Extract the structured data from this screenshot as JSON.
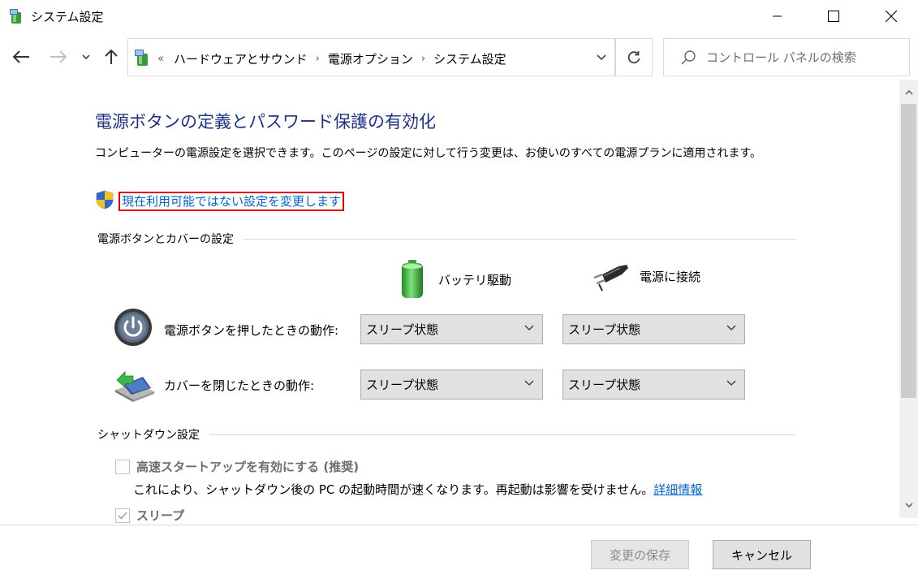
{
  "window": {
    "title": "システム設定"
  },
  "address": {
    "crumb_prefix": "«",
    "crumbs": [
      "ハードウェアとサウンド",
      "電源オプション",
      "システム設定"
    ],
    "separator": "›"
  },
  "search": {
    "placeholder": "コントロール パネルの検索"
  },
  "main": {
    "title": "電源ボタンの定義とパスワード保護の有効化",
    "description": "コンピューターの電源設定を選択できます。このページの設定に対して行う変更は、お使いのすべての電源プランに適用されます。",
    "change_link": "現在利用可能ではない設定を変更します",
    "power_section": "電源ボタンとカバーの設定",
    "col_battery": "バッテリ駆動",
    "col_plugged": "電源に接続",
    "row_power_label": "電源ボタンを押したときの動作:",
    "row_lid_label": "カバーを閉じたときの動作:",
    "power_battery_value": "スリープ状態",
    "power_plugged_value": "スリープ状態",
    "lid_battery_value": "スリープ状態",
    "lid_plugged_value": "スリープ状態",
    "shutdown_section": "シャットダウン設定",
    "fast_startup_label": "高速スタートアップを有効にする (推奨)",
    "fast_startup_desc": "これにより、シャットダウン後の PC の起動時間が速くなります。再起動は影響を受けません。",
    "more_info_link": "詳細情報",
    "sleep_label": "スリープ"
  },
  "footer": {
    "save_label": "変更の保存",
    "cancel_label": "キャンセル"
  },
  "colors": {
    "title_blue": "#1e3287",
    "link_blue": "#0066cc",
    "highlight_red": "#e00000"
  }
}
